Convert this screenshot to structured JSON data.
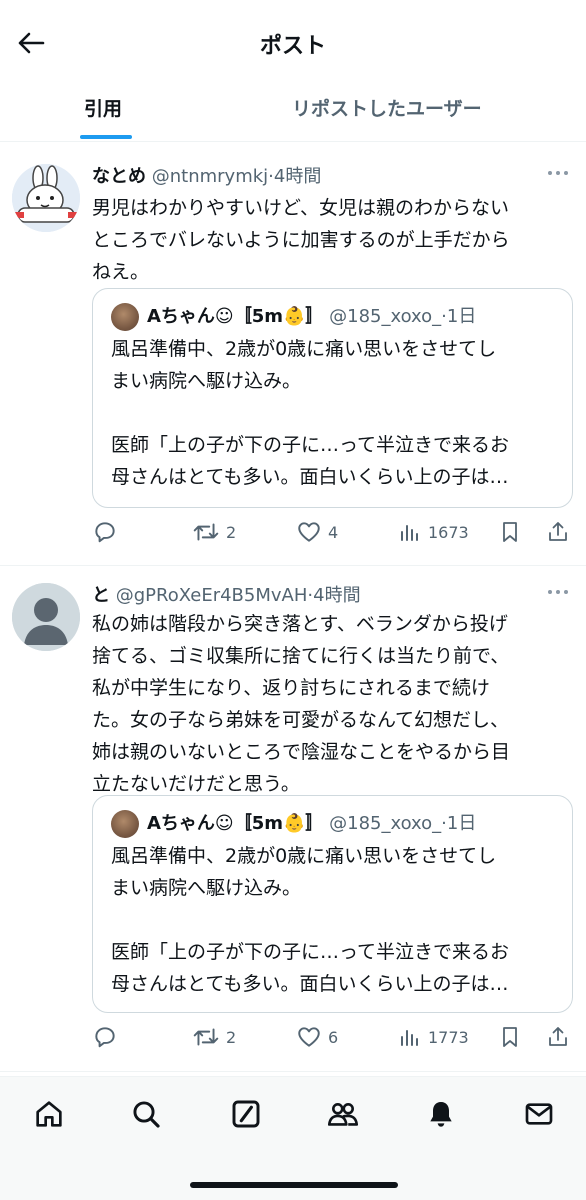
{
  "header": {
    "title": "ポスト",
    "back_icon": "arrow-left-icon"
  },
  "tabs": [
    {
      "label": "引用",
      "active": true
    },
    {
      "label": "リポストしたユーザー",
      "active": false
    }
  ],
  "accent_color": "#1d9bf0",
  "posts": [
    {
      "display_name": "なとめ",
      "handle": "@ntnmrymkj",
      "time_sep": "·",
      "time": "4時間",
      "text": "男児はわかりやすいけど、女児は親のわからない\nところでバレないように加害するのが上手だから\nねえ。",
      "quote": {
        "display_name": "Aちゃん☺︎〚5m👶〛",
        "handle": "@185_xoxo_",
        "time_sep": "·",
        "time": "1日",
        "text": "風呂準備中、2歳が0歳に痛い思いをさせてし\nまい病院へ駆け込み。\n\n医師「上の子が下の子に…って半泣きで来るお\n母さんはとても多い。面白いくらい上の子は…"
      },
      "stats": {
        "replies": "",
        "reposts": "2",
        "likes": "4",
        "views": "1673"
      }
    },
    {
      "display_name": "と",
      "handle": "@gPRoXeEr4B5MvAH",
      "time_sep": "·",
      "time": "4時間",
      "text": "私の姉は階段から突き落とす、ベランダから投げ\n捨てる、ゴミ収集所に捨てに行くは当たり前で、\n私が中学生になり、返り討ちにされるまで続け\nた。女の子なら弟妹を可愛がるなんて幻想だし、\n姉は親のいないところで陰湿なことをやるから目\n立たないだけだと思う。",
      "quote": {
        "display_name": "Aちゃん☺︎〚5m👶〛",
        "handle": "@185_xoxo_",
        "time_sep": "·",
        "time": "1日",
        "text": "風呂準備中、2歳が0歳に痛い思いをさせてし\nまい病院へ駆け込み。\n\n医師「上の子が下の子に…って半泣きで来るお\n母さんはとても多い。面白いくらい上の子は…"
      },
      "stats": {
        "replies": "",
        "reposts": "2",
        "likes": "6",
        "views": "1773"
      }
    }
  ],
  "bottom_nav": [
    "home-icon",
    "search-icon",
    "grok-icon",
    "communities-icon",
    "notifications-icon",
    "messages-icon"
  ]
}
